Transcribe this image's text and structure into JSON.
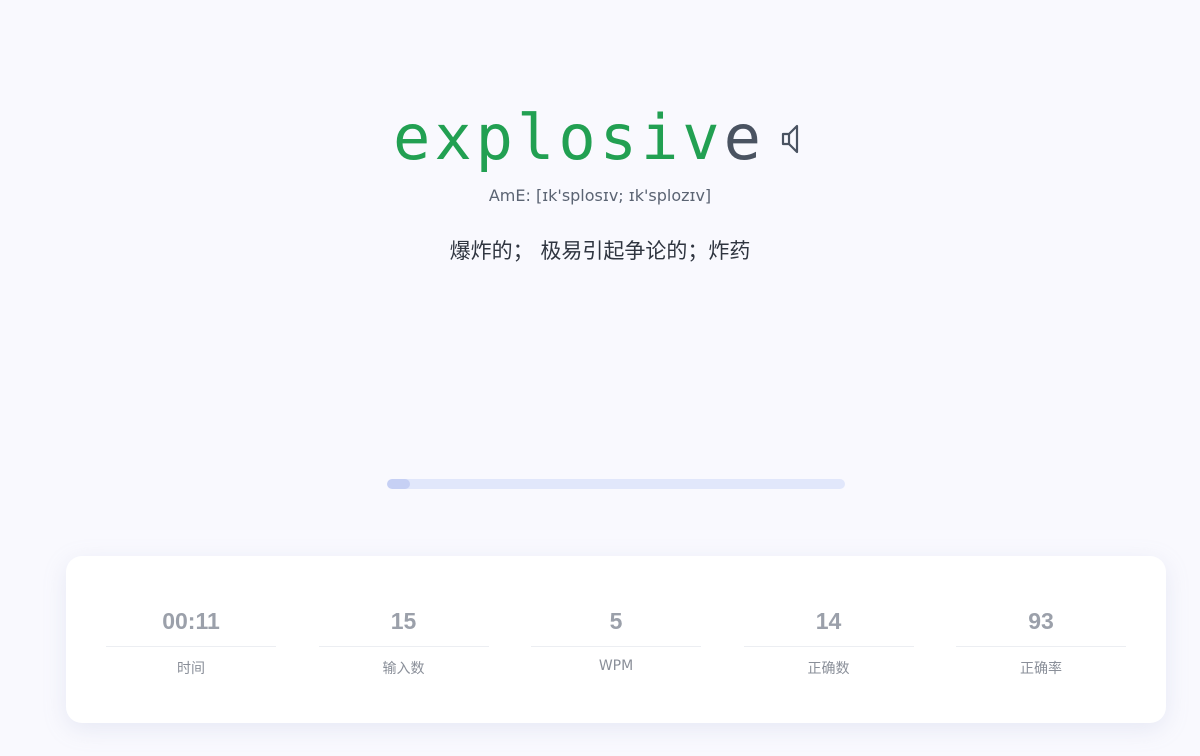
{
  "word": {
    "typed": "explosiv",
    "remaining": "e"
  },
  "icons": {
    "speaker": "speaker-icon"
  },
  "phonetic": "AmE: [ɪk'splosɪv; ɪk'splozɪv]",
  "translation": "爆炸的； 极易引起争论的；炸药",
  "progress": {
    "fraction": 0.05
  },
  "colors": {
    "typed": "#22a052",
    "pending": "#4a5361",
    "progress_track": "#e1e7fb",
    "progress_fill": "#c6d0f4"
  },
  "stats": [
    {
      "value": "00:11",
      "label": "时间"
    },
    {
      "value": "15",
      "label": "输入数"
    },
    {
      "value": "5",
      "label": "WPM"
    },
    {
      "value": "14",
      "label": "正确数"
    },
    {
      "value": "93",
      "label": "正确率"
    }
  ]
}
